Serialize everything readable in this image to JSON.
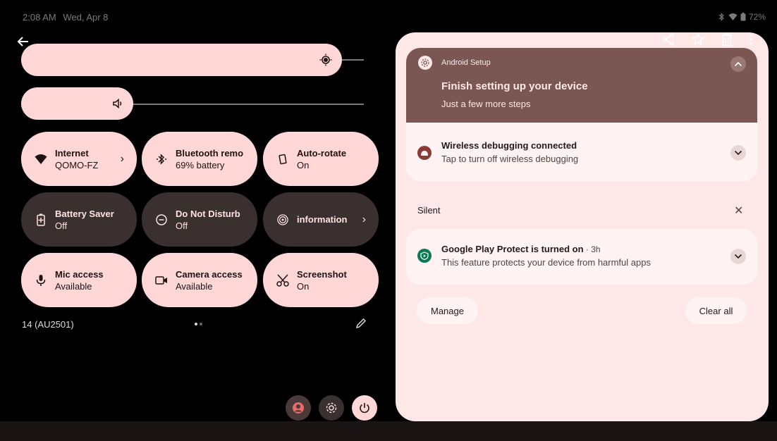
{
  "status_bar": {
    "time": "2:08 AM",
    "date": "Wed, Apr 8",
    "battery": "72%",
    "icons": [
      "bluetooth-icon",
      "wifi-icon",
      "battery-icon"
    ]
  },
  "quick_settings": {
    "brightness": {
      "level": 0.91,
      "icon": "brightness-icon"
    },
    "volume": {
      "level": 0.3,
      "icon": "volume-icon"
    },
    "tiles": [
      {
        "title": "Internet",
        "subtitle": "QOMO-FZ",
        "state": "on",
        "icon": "wifi-icon",
        "chevron": "›"
      },
      {
        "title": "Bluetooth remo",
        "subtitle": "69% battery",
        "state": "on",
        "icon": "bluetooth-icon"
      },
      {
        "title": "Auto-rotate",
        "subtitle": "On",
        "state": "on",
        "icon": "rotate-icon"
      },
      {
        "title": "Battery Saver",
        "subtitle": "Off",
        "state": "off",
        "icon": "battery-saver-icon"
      },
      {
        "title": "Do Not Disturb",
        "subtitle": "Off",
        "state": "off",
        "icon": "dnd-icon"
      },
      {
        "title": "information",
        "subtitle": "",
        "state": "off",
        "icon": "fingerprint-icon",
        "chevron": "›"
      },
      {
        "title": "Mic access",
        "subtitle": "Available",
        "state": "on",
        "icon": "mic-icon"
      },
      {
        "title": "Camera access",
        "subtitle": "Available",
        "state": "on",
        "icon": "camera-icon"
      },
      {
        "title": "Screenshot",
        "subtitle": "On",
        "state": "on",
        "icon": "scissors-icon"
      }
    ],
    "build": "14 (AU2501)",
    "page_count": 2,
    "current_page": 1
  },
  "notifications": {
    "setup": {
      "app": "Android Setup",
      "title": "Finish setting up your device",
      "subtitle": "Just a few more steps"
    },
    "debug": {
      "title": "Wireless debugging connected",
      "subtitle": "Tap to turn off wireless debugging"
    },
    "silent_label": "Silent",
    "play_protect": {
      "title": "Google Play Protect is turned on",
      "meta": " · 3h",
      "subtitle": "This feature protects your device from harmful apps"
    },
    "manage_label": "Manage",
    "clear_all_label": "Clear all"
  },
  "colors": {
    "tile_on": "#ffd7d7",
    "tile_off": "#3a3030",
    "panel_bg": "#fde8e7",
    "setup_card": "#7a5752",
    "accent_debug": "#8b3a36",
    "accent_protect": "#0b7a55"
  }
}
